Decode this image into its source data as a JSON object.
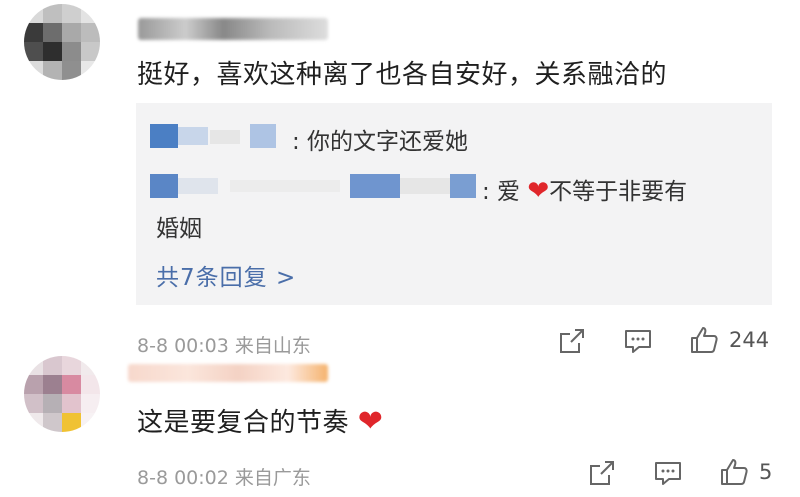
{
  "comments": [
    {
      "text": "挺好，喜欢这种离了也各自安好，关系融洽的",
      "meta": "8-8 00:03  来自山东",
      "like_count": "244",
      "replies": [
        {
          "text": ": 你的文字还爱她"
        },
        {
          "text_before": ": 爱 ",
          "text_after": "不等于非要有",
          "text_wrap": "婚姻"
        }
      ],
      "more_replies": "共7条回复 >"
    },
    {
      "text": "这是要复合的节奏",
      "meta": "8-8 00:02  来自广东",
      "like_count": "5"
    }
  ],
  "colors": {
    "link": "#4a6ea9",
    "heart": "#e0262b",
    "meta": "#9a9a9a",
    "reply_bg": "#f3f3f4"
  },
  "icons": [
    "share-icon",
    "comment-icon",
    "like-thumb-icon",
    "heart-icon"
  ]
}
